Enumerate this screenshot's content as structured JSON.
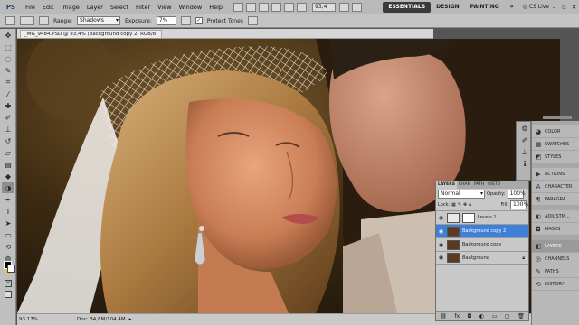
{
  "app": {
    "logo": "PS"
  },
  "menu": [
    "File",
    "Edit",
    "Image",
    "Layer",
    "Select",
    "Filter",
    "View",
    "Window",
    "Help"
  ],
  "zoom_select": "93,4",
  "workspaces": [
    {
      "label": "ESSENTIALS",
      "active": true
    },
    {
      "label": "DESIGN",
      "active": false
    },
    {
      "label": "PAINTING",
      "active": false
    },
    {
      "label": "»",
      "active": false
    }
  ],
  "cs_live": "CS Live",
  "options": {
    "range_label": "Range:",
    "range_value": "Shadows",
    "exposure_label": "Exposure:",
    "exposure_value": "7%",
    "protect_tones_label": "Protect Tones",
    "protect_tones_checked": true
  },
  "document": {
    "tab_title": "_MG_9484.PSD @ 93,4% (Background copy 2, RGB/8)",
    "zoom": "93.17%",
    "doc_size": "Doc: 34,8M/104,4M"
  },
  "layers_panel": {
    "tabs": [
      "LAYERS",
      "CHAN",
      "PATH",
      "HISTO"
    ],
    "blend_mode": "Normal",
    "opacity_label": "Opacity:",
    "opacity_value": "100%",
    "lock_label": "Lock:",
    "fill_label": "Fill:",
    "fill_value": "100%",
    "layers": [
      {
        "name": "Levels 1",
        "selected": false,
        "type": "adjustment"
      },
      {
        "name": "Background copy 2",
        "selected": true,
        "type": "image"
      },
      {
        "name": "Background copy",
        "selected": false,
        "type": "image"
      },
      {
        "name": "Background",
        "selected": false,
        "type": "image",
        "italic": true
      }
    ]
  },
  "dock": {
    "group1": [
      {
        "label": "COLOR",
        "icon": "color-icon"
      },
      {
        "label": "SWATCHES",
        "icon": "swatches-icon"
      },
      {
        "label": "STYLES",
        "icon": "styles-icon"
      }
    ],
    "group2": [
      {
        "label": "ACTIONS",
        "icon": "actions-icon"
      },
      {
        "label": "CHARACTER",
        "icon": "character-icon"
      },
      {
        "label": "PARAGRA...",
        "icon": "paragraph-icon"
      }
    ],
    "group3": [
      {
        "label": "ADJUSTM...",
        "icon": "adjustments-icon"
      },
      {
        "label": "MASKS",
        "icon": "masks-icon"
      }
    ],
    "group4": [
      {
        "label": "LAYERS",
        "icon": "layers-icon",
        "active": true
      },
      {
        "label": "CHANNELS",
        "icon": "channels-icon"
      },
      {
        "label": "PATHS",
        "icon": "paths-icon"
      },
      {
        "label": "HISTORY",
        "icon": "history-icon"
      }
    ]
  },
  "colors": {
    "accent": "#3e7fd8",
    "chrome": "#b9b9b9"
  }
}
